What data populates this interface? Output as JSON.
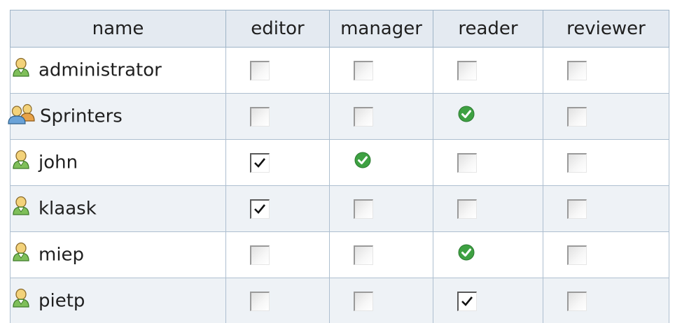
{
  "table": {
    "columns": [
      "name",
      "editor",
      "manager",
      "reader",
      "reviewer"
    ],
    "rows": [
      {
        "name": "administrator",
        "type": "user",
        "cells": [
          "unchecked",
          "unchecked",
          "unchecked",
          "unchecked"
        ]
      },
      {
        "name": "Sprinters",
        "type": "group",
        "cells": [
          "unchecked",
          "unchecked",
          "acquired",
          "unchecked"
        ]
      },
      {
        "name": "john",
        "type": "user",
        "cells": [
          "checked",
          "acquired",
          "unchecked",
          "unchecked"
        ]
      },
      {
        "name": "klaask",
        "type": "user",
        "cells": [
          "checked",
          "unchecked",
          "unchecked",
          "unchecked"
        ]
      },
      {
        "name": "miep",
        "type": "user",
        "cells": [
          "unchecked",
          "unchecked",
          "acquired",
          "unchecked"
        ]
      },
      {
        "name": "pietp",
        "type": "user",
        "cells": [
          "unchecked",
          "unchecked",
          "checked",
          "unchecked"
        ]
      }
    ]
  },
  "icons": {
    "user": "user-icon",
    "group": "group-icon",
    "acquired": "acquired-role-icon"
  },
  "colors": {
    "header_bg": "#e4eaf1",
    "alt_row_bg": "#eef2f6",
    "border": "#aebfd0",
    "acquired_green": "#3ea142"
  }
}
